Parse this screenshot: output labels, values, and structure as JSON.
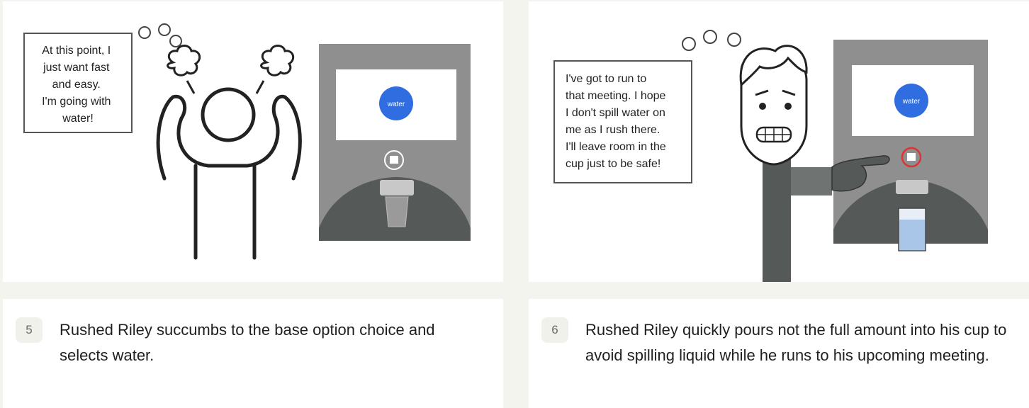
{
  "panels": [
    {
      "step": "5",
      "speech": [
        "At this point, I",
        "just want fast",
        "and easy.",
        "I'm going with",
        "water!"
      ],
      "screen_button": "water",
      "caption": "Rushed Riley succumbs to the base option choice and selects water."
    },
    {
      "step": "6",
      "speech": [
        "I've got to run to",
        "that meeting. I hope",
        "I don't spill water on",
        "me as I rush there.",
        "I'll leave room in the",
        "cup just to be safe!"
      ],
      "screen_button": "water",
      "caption": "Rushed Riley quickly pours not the full amount into his cup to avoid spilling liquid while he runs to his upcoming meeting."
    }
  ],
  "colors": {
    "page_bg": "#f4f4ef",
    "machine_body": "#8f8f8f",
    "machine_base": "#555a58",
    "water_button": "#2f6de0",
    "water_fill": "#a9c6e8"
  }
}
